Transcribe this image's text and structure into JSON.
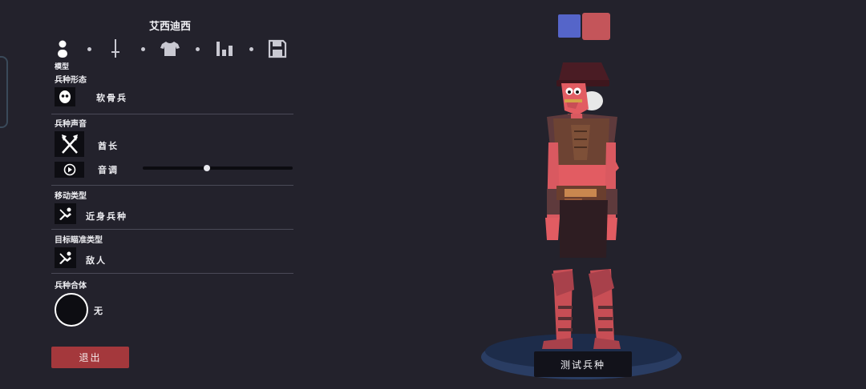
{
  "unit_name": "艾西迪西",
  "tabs": [
    {
      "id": "model",
      "icon": "person-icon",
      "active": true
    },
    {
      "id": "weapon",
      "icon": "sword-icon",
      "active": false
    },
    {
      "id": "clothing",
      "icon": "shirt-icon",
      "active": false
    },
    {
      "id": "stats",
      "icon": "bar-chart-icon",
      "active": false
    },
    {
      "id": "save",
      "icon": "save-icon",
      "active": false
    }
  ],
  "active_tab_label": "模型",
  "sections": {
    "base": {
      "title": "兵种形态",
      "value": "软骨兵",
      "icon": "head-icon"
    },
    "voice": {
      "title": "兵种声音",
      "value": "酋长",
      "icon": "axes-icon",
      "pitch_label": "音调",
      "pitch_level": 0.43,
      "play_icon": "play-icon"
    },
    "movement": {
      "title": "移动类型",
      "value": "近身兵种",
      "icon": "melee-icon"
    },
    "targeting": {
      "title": "目标瞄准类型",
      "value": "敌人",
      "icon": "target-enemy-icon"
    },
    "merge": {
      "title": "兵种合体",
      "value": "无",
      "icon": "empty-circle-icon"
    }
  },
  "buttons": {
    "exit": "退出",
    "test": "测试兵种"
  },
  "team_colors": {
    "blue": "#5565c9",
    "red": "#c4555a"
  },
  "colors": {
    "background": "#23222c",
    "panel_icon_bg": "#0d0d12",
    "exit": "#a4383c",
    "unit_skin": "#e25c62"
  }
}
